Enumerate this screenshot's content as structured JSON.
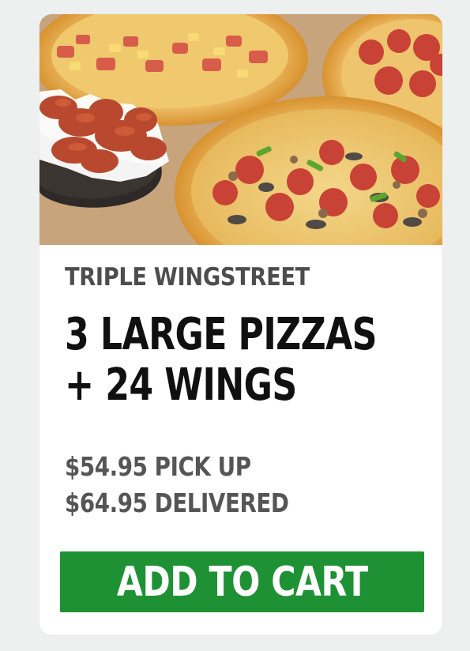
{
  "offer": {
    "subtitle": "TRIPLE WINGSTREET",
    "title_line_1": "3 LARGE PIZZAS",
    "title_line_2": "+ 24 WINGS",
    "price_line_1": "$54.95 PICK UP",
    "price_line_2": "$64.95 DELIVERED",
    "cta_label": "ADD TO CART"
  },
  "colors": {
    "page_background": "#eef0ef",
    "card_background": "#ffffff",
    "cta_background": "#1f9135",
    "title_text": "#101010",
    "subtitle_text": "#4d4d4d",
    "price_text": "#555555"
  }
}
